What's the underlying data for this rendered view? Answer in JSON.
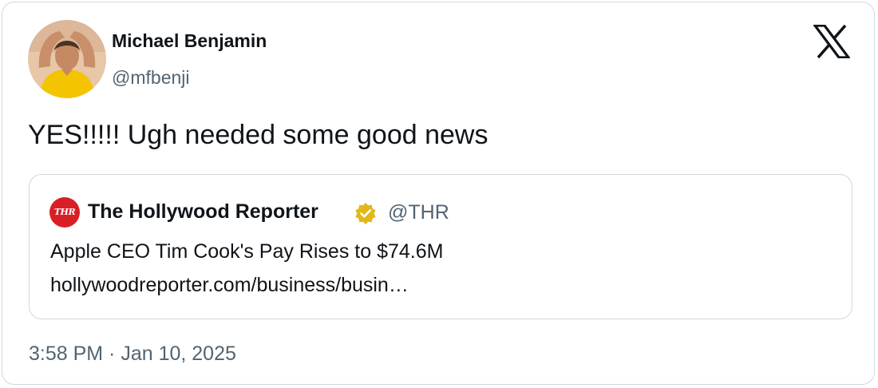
{
  "author": {
    "name": "Michael Benjamin",
    "handle": "@mfbenji"
  },
  "tweet": {
    "text": "YES!!!!! Ugh needed some good news",
    "timestamp": "3:58 PM · Jan 10, 2025"
  },
  "quoted_tweet": {
    "logo_text": "THR",
    "author_name": "The Hollywood Reporter",
    "author_handle": "@THR",
    "verified": true,
    "headline": "Apple CEO Tim Cook's Pay Rises to $74.6M",
    "link": "hollywoodreporter.com/business/busin…"
  },
  "icons": {
    "platform": "x-logo-icon",
    "verified": "verified-badge-icon"
  },
  "colors": {
    "text_primary": "#0f1419",
    "text_secondary": "#536471",
    "border": "#cfd9de",
    "thr_red": "#d91f26",
    "verified_gold": "#e2b719",
    "avatar_shirt": "#f5c400"
  }
}
